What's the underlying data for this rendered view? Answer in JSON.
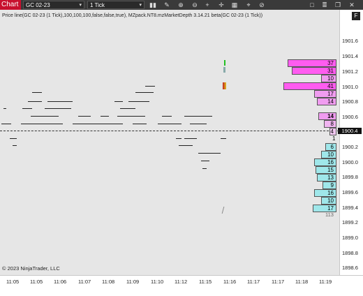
{
  "toolbar": {
    "chart_label": "Chart",
    "instrument": "GC 02-23",
    "interval": "1 Tick",
    "buttons": [
      "bars-icon",
      "pencil-icon",
      "zoom-in-icon",
      "zoom-out-icon",
      "crosshair-icon",
      "plus-icon",
      "grid-icon",
      "pin-icon",
      "stop-icon",
      "square-icon",
      "list-icon",
      "window-icon",
      "close-icon"
    ]
  },
  "header": {
    "text": "Price line(GC 02-23 (1 Tick),100,100,100,false,false,true), MZpack.NT8.mzMarketDepth 3.14.21 beta(GC 02-23 (1 Tick))",
    "f_button": "F"
  },
  "y_axis": {
    "labels": [
      "1901.6",
      "1901.4",
      "1901.2",
      "1901.0",
      "1900.8",
      "1900.6",
      "1900.2",
      "1900.0",
      "1899.8",
      "1899.6",
      "1899.4",
      "1899.2",
      "1899.0",
      "1898.8",
      "1898.6"
    ],
    "current_price": "1900.4"
  },
  "x_axis": {
    "labels": [
      "11:05",
      "11:05",
      "11:06",
      "11:07",
      "11:08",
      "11:09",
      "11:10",
      "11:10",
      "11:12",
      "11:15",
      "11:16",
      "11:17",
      "11:17",
      "11:18",
      "11:19"
    ]
  },
  "depth": {
    "asks": [
      "37",
      "31",
      "10",
      "41",
      "17",
      "14",
      "14",
      "8",
      "4"
    ],
    "bids": [
      "1",
      "6",
      "10",
      "16",
      "15",
      "13",
      "9",
      "16",
      "10",
      "17"
    ],
    "total": "113"
  },
  "copyright": "© 2023 NinjaTrader, LLC",
  "colors": {
    "ask_strong": "#ff5cf0",
    "ask_medium": "#f09cf0",
    "bid": "#9fe7ea",
    "toolbar": "#3a3a3a",
    "chart_tab": "#c8102e",
    "chart_bg": "#e6e6e6"
  }
}
